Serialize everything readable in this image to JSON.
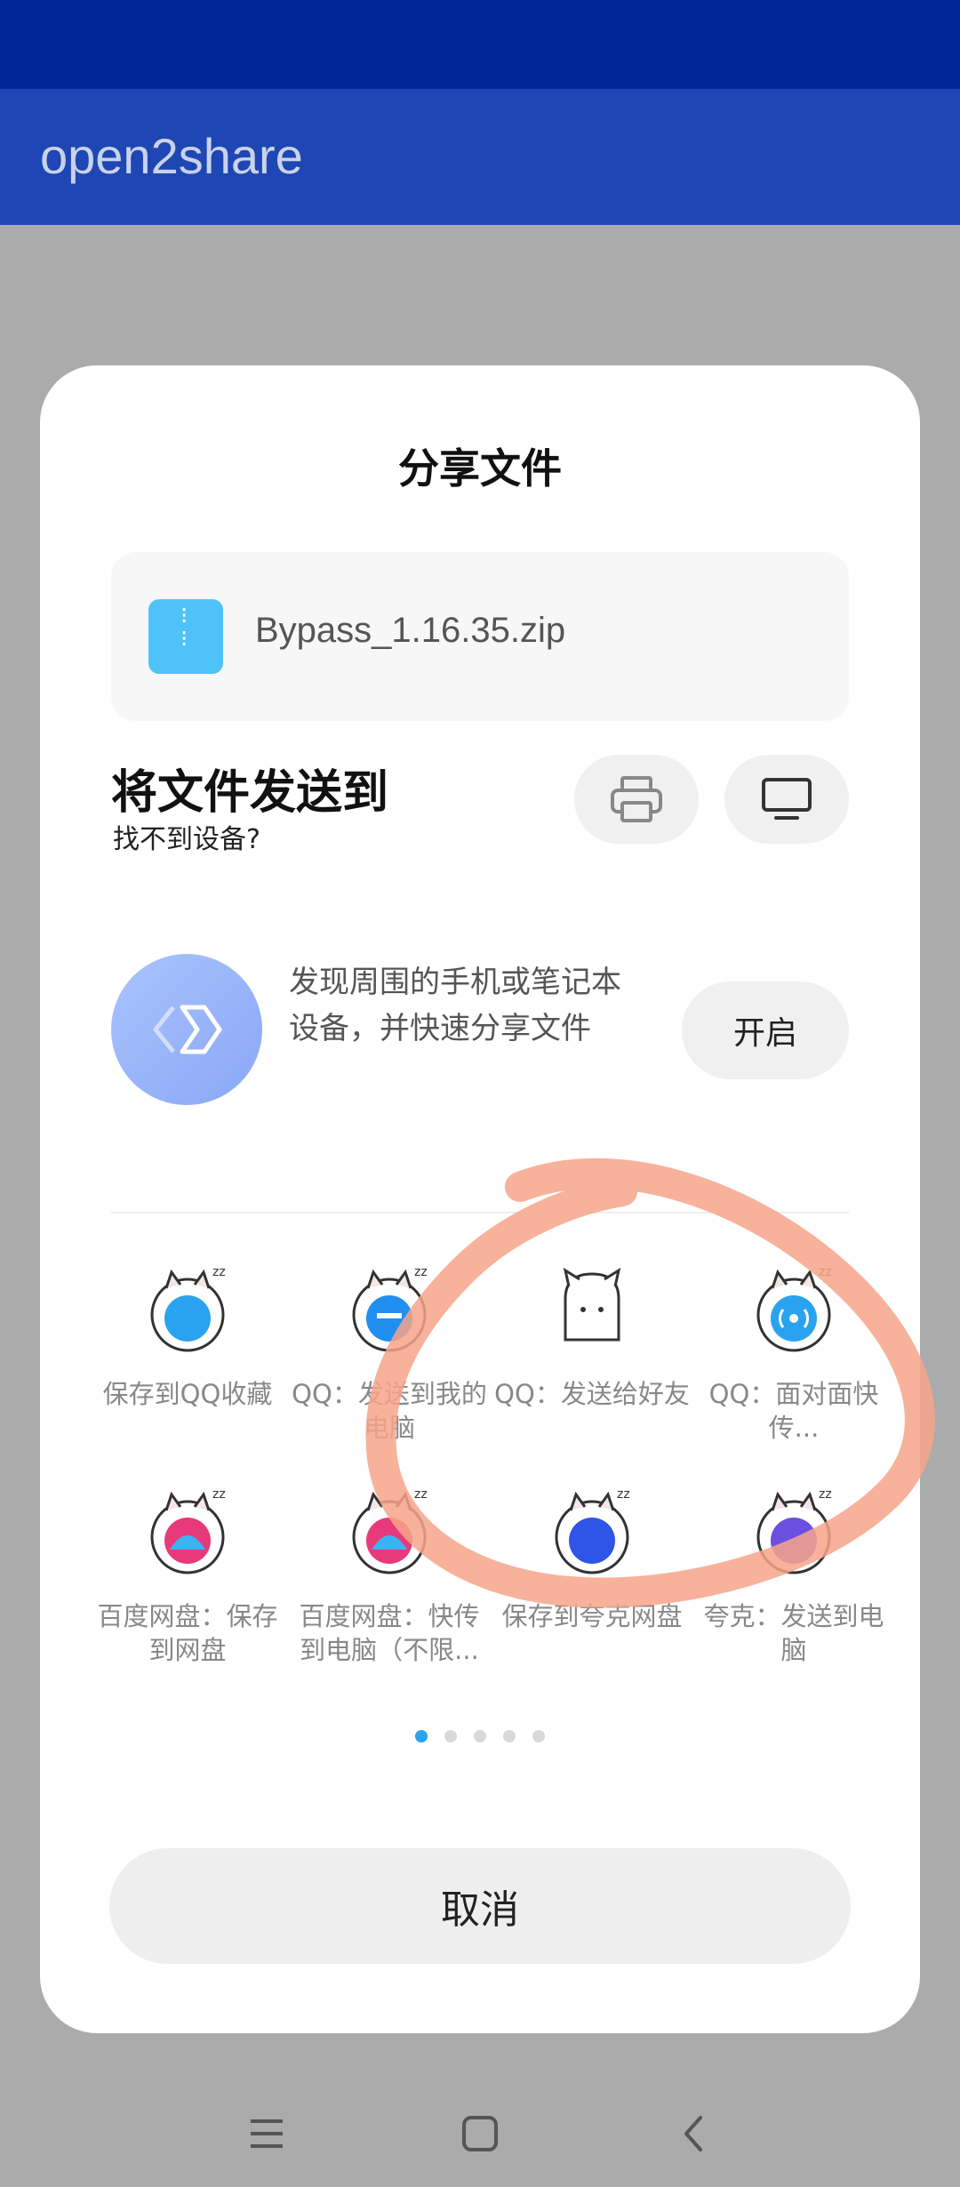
{
  "app": {
    "title": "open2share"
  },
  "sheet": {
    "title": "分享文件",
    "file": {
      "name": "Bypass_1.16.35.zip",
      "icon": "zip-file-icon"
    },
    "send": {
      "title": "将文件发送到",
      "subtitle": "找不到设备?",
      "print_icon": "printer-icon",
      "screen_icon": "monitor-icon"
    },
    "discover": {
      "text": "发现周围的手机或笔记本设备，并快速分享文件",
      "button": "开启"
    },
    "apps": [
      {
        "label": "保存到QQ收藏",
        "icon": "qq-favorites-icon",
        "accent": "#29a3ef"
      },
      {
        "label": "QQ：发送到我的电脑",
        "icon": "qq-my-computer-icon",
        "accent": "#1f8ff0"
      },
      {
        "label": "QQ：发送给好友",
        "icon": "qq-friend-icon",
        "accent": "#444444"
      },
      {
        "label": "QQ：面对面快传...",
        "icon": "qq-face-to-face-icon",
        "accent": "#29a3ef"
      },
      {
        "label": "百度网盘：保存到网盘",
        "icon": "baidu-netdisk-save-icon",
        "accent": "#e8397a"
      },
      {
        "label": "百度网盘：快传到电脑（不限...",
        "icon": "baidu-netdisk-transfer-icon",
        "accent": "#e8397a"
      },
      {
        "label": "保存到夸克网盘",
        "icon": "quark-netdisk-icon",
        "accent": "#2f55e6"
      },
      {
        "label": "夸克：发送到电脑",
        "icon": "quark-send-icon",
        "accent": "#6a4fe0"
      }
    ],
    "pager": {
      "count": 5,
      "active": 1
    },
    "cancel": "取消"
  },
  "navbar": {
    "menu_icon": "menu-icon",
    "home_icon": "home-icon",
    "back_icon": "back-icon"
  },
  "colors": {
    "statusbar": "#00269a",
    "appbar": "#1e46b4",
    "annotation": "#f7a58a"
  }
}
